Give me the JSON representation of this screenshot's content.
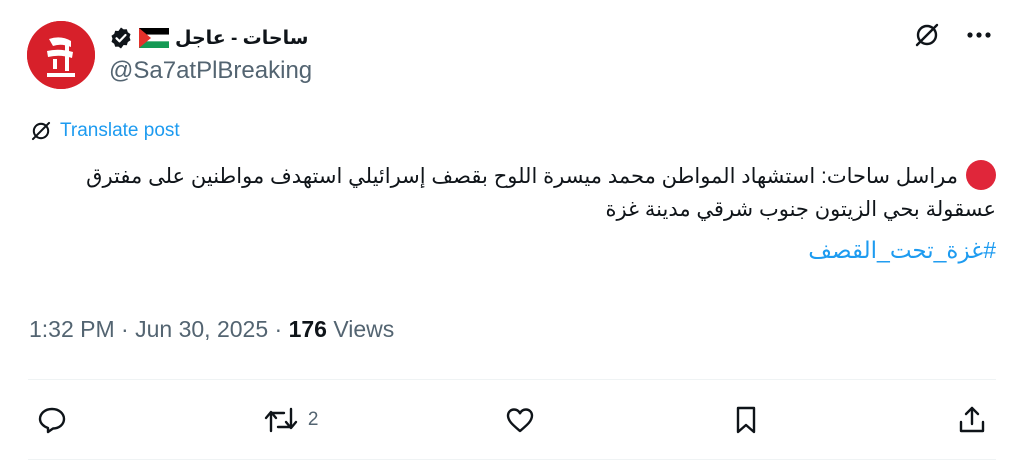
{
  "author": {
    "name": "ساحات - عاجل",
    "handle": "@Sa7atPlBreaking",
    "verified": true,
    "flag": "palestine-flag-icon",
    "avatar_color": "#d7202a"
  },
  "top_actions": [
    "grok-icon",
    "more-icon"
  ],
  "translate": {
    "label": "Translate post"
  },
  "tweet": {
    "prefix_icon": "red-circle-icon",
    "text": "مراسل ساحات: استشهاد المواطن محمد ميسرة اللوح بقصف إسرائيلي استهدف مواطنين على مفترق عسقولة بحي الزيتون جنوب شرقي مدينة غزة",
    "hashtag": "#غزة_تحت_القصف"
  },
  "meta": {
    "time": "1:32 PM",
    "date": "Jun 30, 2025",
    "views_count": "176",
    "views_label": "Views"
  },
  "actions": {
    "reply_count": "",
    "repost_count": "2",
    "like_count": "",
    "bookmark_count": ""
  },
  "colors": {
    "accent": "#1d9bf0",
    "muted": "#536471",
    "text": "#0f1419",
    "divider": "#eff3f4"
  }
}
